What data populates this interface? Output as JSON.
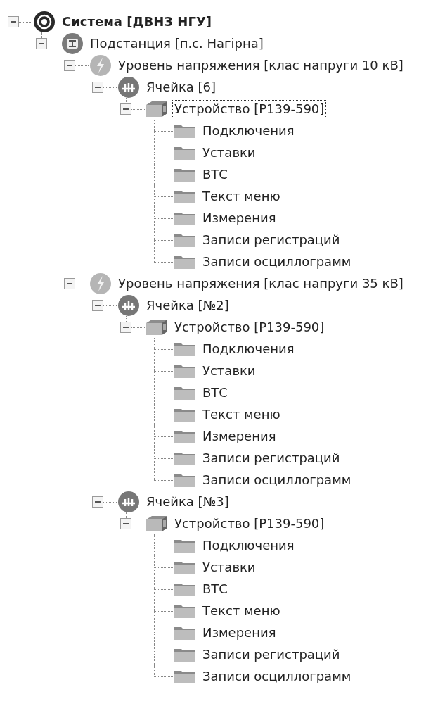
{
  "tree": [
    {
      "kind": "system",
      "label": "Система [ДВНЗ НГУ]",
      "expanded": true,
      "selected": false,
      "children": [
        {
          "kind": "substation",
          "label": "Подстанция [п.с. Нагірна]",
          "expanded": true,
          "selected": false,
          "children": [
            {
              "kind": "level",
              "label": "Уровень напряжения [клас напруги 10 кВ]",
              "expanded": true,
              "selected": false,
              "children": [
                {
                  "kind": "cell",
                  "label": "Ячейка [6]",
                  "expanded": true,
                  "selected": false,
                  "children": [
                    {
                      "kind": "device",
                      "label": "Устройство [Р139-590]",
                      "expanded": true,
                      "selected": true,
                      "children": [
                        {
                          "kind": "folder",
                          "label": "Подключения",
                          "selected": false
                        },
                        {
                          "kind": "folder",
                          "label": "Уставки",
                          "selected": false
                        },
                        {
                          "kind": "folder",
                          "label": "ВТС",
                          "selected": false
                        },
                        {
                          "kind": "folder",
                          "label": "Текст меню",
                          "selected": false
                        },
                        {
                          "kind": "folder",
                          "label": "Измерения",
                          "selected": false
                        },
                        {
                          "kind": "folder",
                          "label": "Записи регистраций",
                          "selected": false
                        },
                        {
                          "kind": "folder",
                          "label": "Записи осциллограмм",
                          "selected": false
                        }
                      ]
                    }
                  ]
                }
              ]
            },
            {
              "kind": "level",
              "label": "Уровень напряжения [клас напруги 35 кВ]",
              "expanded": true,
              "selected": false,
              "children": [
                {
                  "kind": "cell",
                  "label": "Ячейка [№2]",
                  "expanded": true,
                  "selected": false,
                  "children": [
                    {
                      "kind": "device",
                      "label": "Устройство [Р139-590]",
                      "expanded": true,
                      "selected": false,
                      "children": [
                        {
                          "kind": "folder",
                          "label": "Подключения",
                          "selected": false
                        },
                        {
                          "kind": "folder",
                          "label": "Уставки",
                          "selected": false
                        },
                        {
                          "kind": "folder",
                          "label": "ВТС",
                          "selected": false
                        },
                        {
                          "kind": "folder",
                          "label": "Текст меню",
                          "selected": false
                        },
                        {
                          "kind": "folder",
                          "label": "Измерения",
                          "selected": false
                        },
                        {
                          "kind": "folder",
                          "label": "Записи регистраций",
                          "selected": false
                        },
                        {
                          "kind": "folder",
                          "label": "Записи осциллограмм",
                          "selected": false
                        }
                      ]
                    }
                  ]
                },
                {
                  "kind": "cell",
                  "label": "Ячейка [№3]",
                  "expanded": true,
                  "selected": false,
                  "children": [
                    {
                      "kind": "device",
                      "label": "Устройство [Р139-590]",
                      "expanded": true,
                      "selected": false,
                      "children": [
                        {
                          "kind": "folder",
                          "label": "Подключения",
                          "selected": false
                        },
                        {
                          "kind": "folder",
                          "label": "Уставки",
                          "selected": false
                        },
                        {
                          "kind": "folder",
                          "label": "ВТС",
                          "selected": false
                        },
                        {
                          "kind": "folder",
                          "label": "Текст меню",
                          "selected": false
                        },
                        {
                          "kind": "folder",
                          "label": "Измерения",
                          "selected": false
                        },
                        {
                          "kind": "folder",
                          "label": "Записи регистраций",
                          "selected": false
                        },
                        {
                          "kind": "folder",
                          "label": "Записи осциллограмм",
                          "selected": false
                        }
                      ]
                    }
                  ]
                }
              ]
            }
          ]
        }
      ]
    }
  ]
}
